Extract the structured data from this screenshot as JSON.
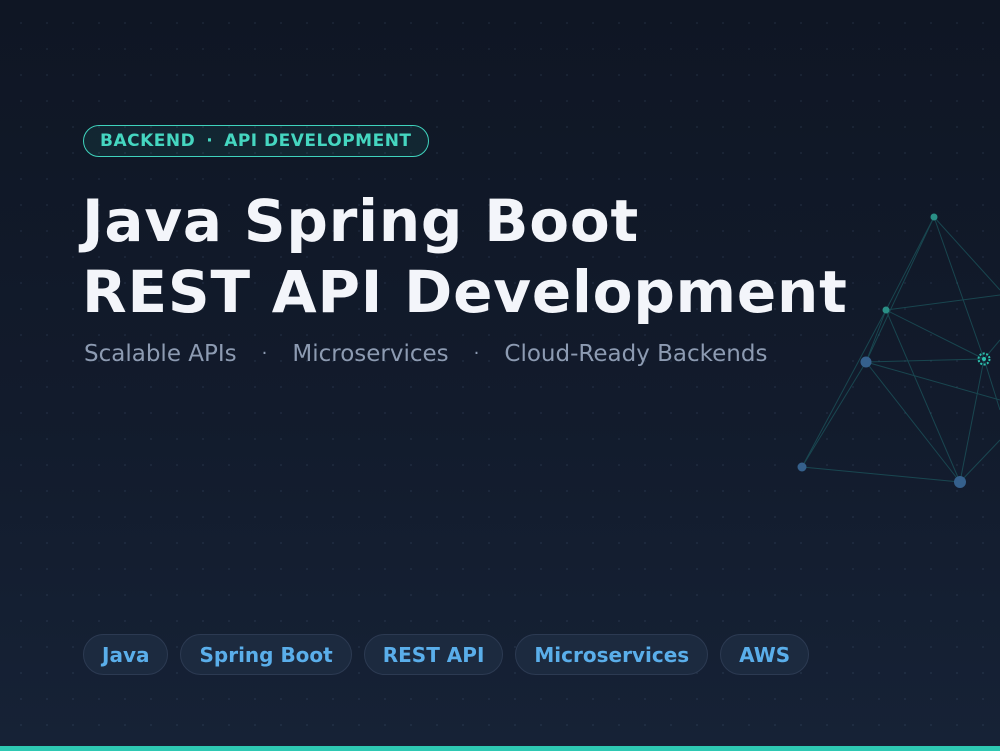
{
  "eyebrow": {
    "primary": "BACKEND",
    "separator": "·",
    "secondary": "API DEVELOPMENT"
  },
  "title": {
    "line1": "Java Spring Boot",
    "line2": "REST API Development"
  },
  "subtitle": {
    "items": [
      "Scalable APIs",
      "Microservices",
      "Cloud-Ready Backends"
    ],
    "separator": "·"
  },
  "tags": [
    "Java",
    "Spring Boot",
    "REST API",
    "Microservices",
    "AWS"
  ],
  "colors": {
    "background": "#121b2c",
    "accent_teal": "#2ec9b3",
    "title_text": "#f3f5fa",
    "subtitle_text": "#8d9bb2",
    "tag_text": "#5aaeea",
    "tag_background": "#1c2a3f"
  },
  "icons": {
    "decoration": "network-graph-icon"
  }
}
